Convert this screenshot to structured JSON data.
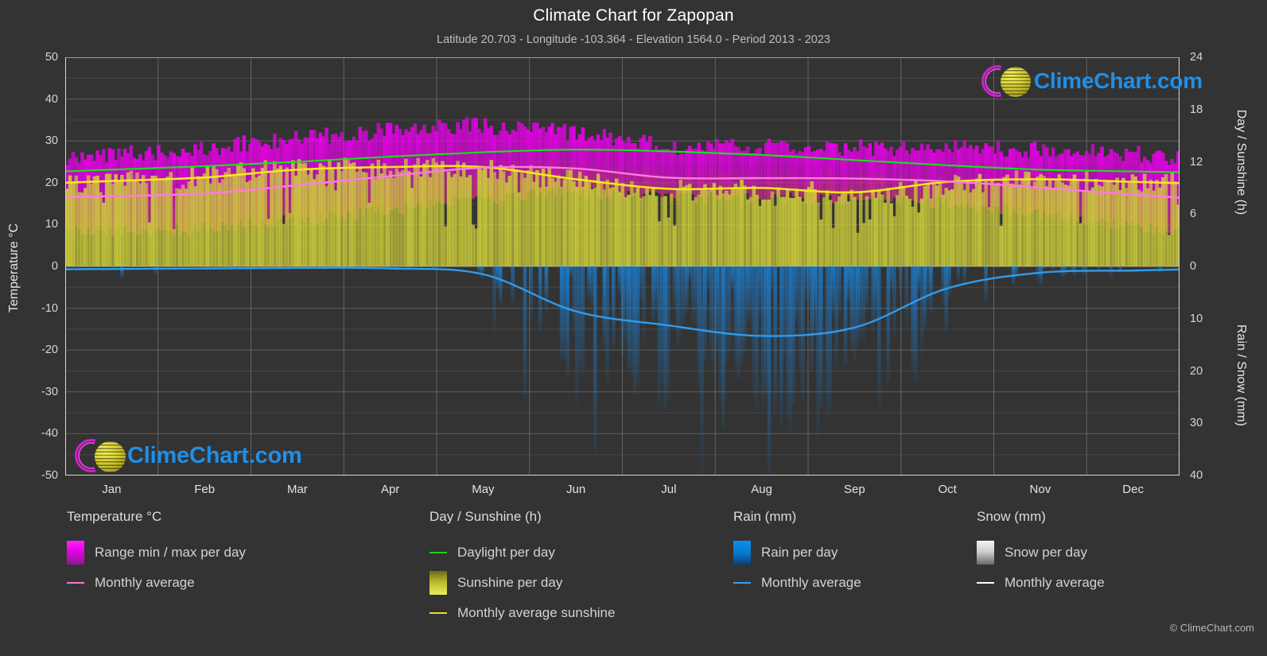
{
  "header": {
    "title": "Climate Chart for Zapopan",
    "subtitle": "Latitude 20.703 - Longitude -103.364 - Elevation 1564.0 - Period 2013 - 2023"
  },
  "watermark": {
    "text": "ClimeChart.com"
  },
  "copyright": "© ClimeChart.com",
  "axes": {
    "left_title": "Temperature °C",
    "right_title_top": "Day / Sunshine (h)",
    "right_title_bottom": "Rain / Snow (mm)",
    "left_ticks": [
      "50",
      "40",
      "30",
      "20",
      "10",
      "0",
      "-10",
      "-20",
      "-30",
      "-40",
      "-50"
    ],
    "right_ticks_top": [
      "24",
      "18",
      "12",
      "6",
      "0"
    ],
    "right_ticks_bottom": [
      "10",
      "20",
      "30",
      "40"
    ],
    "x_ticks": [
      "Jan",
      "Feb",
      "Mar",
      "Apr",
      "May",
      "Jun",
      "Jul",
      "Aug",
      "Sep",
      "Oct",
      "Nov",
      "Dec"
    ]
  },
  "legend": {
    "columns": [
      {
        "header": "Temperature °C",
        "entries": [
          {
            "label": "Range min / max per day",
            "marker": "swatch",
            "color": "#e800e8"
          },
          {
            "label": "Monthly average",
            "marker": "line",
            "color": "#f86edc"
          }
        ]
      },
      {
        "header": "Day / Sunshine (h)",
        "entries": [
          {
            "label": "Daylight per day",
            "marker": "line",
            "color": "#17d717"
          },
          {
            "label": "Sunshine per day",
            "marker": "swatch",
            "color": "#e8e84a"
          },
          {
            "label": "Monthly average sunshine",
            "marker": "line",
            "color": "#e8e02a"
          }
        ]
      },
      {
        "header": "Rain (mm)",
        "entries": [
          {
            "label": "Rain per day",
            "marker": "swatch",
            "color": "#0a86e0"
          },
          {
            "label": "Monthly average",
            "marker": "line",
            "color": "#3a9ee8"
          }
        ]
      },
      {
        "header": "Snow (mm)",
        "entries": [
          {
            "label": "Snow per day",
            "marker": "swatch",
            "color": "#e8e8e8"
          },
          {
            "label": "Monthly average",
            "marker": "line",
            "color": "#ffffff"
          }
        ]
      }
    ]
  },
  "colors": {
    "background": "#333333",
    "grid": "#8a8a8a",
    "axis": "#d8d8d8",
    "temp_range": "#e800e8",
    "temp_avg": "#ff7ae0",
    "daylight": "#18e018",
    "sunshine_band": "#cfcf3a",
    "sunshine_avg": "#f5e61e",
    "rain_band": "#1a7fd4",
    "rain_avg": "#2e9ced",
    "snow": "#e0e0e0"
  },
  "chart_data": {
    "type": "area",
    "title": "Climate Chart for Zapopan",
    "subtitle": "Latitude 20.703 - Longitude -103.364 - Elevation 1564.0 - Period 2013 - 2023",
    "xlabel": "",
    "ylabel": "Temperature °C",
    "ylim": [
      -50,
      50
    ],
    "y2lim_day": [
      0,
      24
    ],
    "y2lim_rain": [
      0,
      40
    ],
    "grid": true,
    "legend_position": "below",
    "categories": [
      "Jan",
      "Feb",
      "Mar",
      "Apr",
      "May",
      "Jun",
      "Jul",
      "Aug",
      "Sep",
      "Oct",
      "Nov",
      "Dec"
    ],
    "series": [
      {
        "name": "Monthly average temperature (°C)",
        "unit": "°C",
        "color": "#ff7ae0",
        "values": [
          16.8,
          17.4,
          19.4,
          21.6,
          23.6,
          23.4,
          21.2,
          21.1,
          21.0,
          20.3,
          18.8,
          17.2
        ]
      },
      {
        "name": "Temperature range max per day (°C)",
        "unit": "°C",
        "color": "#e800e8",
        "values": [
          25.8,
          27.2,
          29.5,
          31.8,
          33.3,
          31.5,
          28.4,
          28.2,
          28.0,
          28.1,
          27.3,
          26.0
        ]
      },
      {
        "name": "Temperature range min per day (°C)",
        "unit": "°C",
        "color": "#e800e8",
        "values": [
          8.2,
          8.6,
          10.4,
          12.9,
          15.6,
          17.4,
          16.6,
          16.4,
          16.3,
          14.4,
          11.0,
          8.8
        ]
      },
      {
        "name": "Daylight per day (h)",
        "unit": "h",
        "color": "#18e018",
        "values": [
          11.1,
          11.5,
          12.0,
          12.6,
          13.1,
          13.4,
          13.2,
          12.8,
          12.2,
          11.6,
          11.1,
          10.9
        ]
      },
      {
        "name": "Monthly average sunshine (h)",
        "unit": "h",
        "color": "#f5e61e",
        "values": [
          9.8,
          10.2,
          11.1,
          11.4,
          11.4,
          10.0,
          8.9,
          9.0,
          8.5,
          9.7,
          10.0,
          9.7
        ]
      },
      {
        "name": "Monthly average rain (mm)",
        "unit": "mm",
        "color": "#2e9ced",
        "values": [
          0.5,
          0.4,
          0.3,
          0.4,
          1.5,
          8.6,
          11.3,
          13.3,
          11.7,
          4.2,
          1.2,
          0.8
        ]
      },
      {
        "name": "Monthly average snow (mm)",
        "unit": "mm",
        "color": "#ffffff",
        "values": [
          0,
          0,
          0,
          0,
          0,
          0,
          0,
          0,
          0,
          0,
          0,
          0
        ]
      }
    ]
  }
}
